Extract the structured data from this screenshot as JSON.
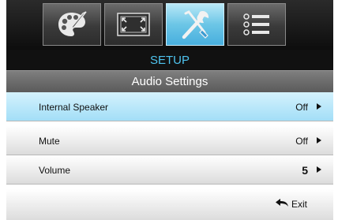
{
  "tabs": [
    {
      "name": "image",
      "icon": "palette-icon",
      "active": false
    },
    {
      "name": "display",
      "icon": "screen-frame-icon",
      "active": false
    },
    {
      "name": "setup",
      "icon": "tools-icon",
      "active": true
    },
    {
      "name": "options",
      "icon": "list-icon",
      "active": false
    }
  ],
  "header": {
    "title": "SETUP"
  },
  "submenu": {
    "title": "Audio Settings"
  },
  "rows": [
    {
      "label": "Internal Speaker",
      "value": "Off"
    },
    {
      "label": "Mute",
      "value": "Off"
    },
    {
      "label": "Volume",
      "value": "5"
    }
  ],
  "exit": {
    "label": "Exit"
  },
  "colors": {
    "accent": "#4fc3ee",
    "selected_row": "#a3def7"
  }
}
